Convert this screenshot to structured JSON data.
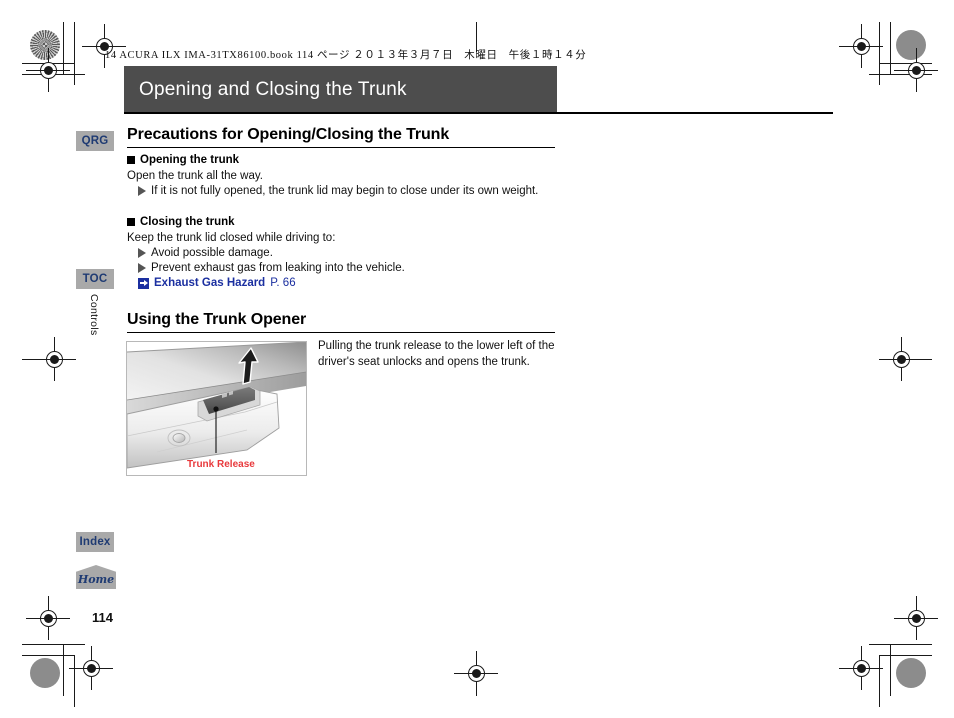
{
  "running_header": "14 ACURA ILX IMA-31TX86100.book  114 ページ  ２０１３年３月７日　木曜日　午後１時１４分",
  "banner": {
    "title": "Opening and Closing the Trunk"
  },
  "side_tabs": {
    "qrg": "QRG",
    "toc": "TOC",
    "index": "Index",
    "home": "Home",
    "chapter": "Controls"
  },
  "sections": [
    {
      "heading": "Precautions for Opening/Closing the Trunk",
      "subsections": [
        {
          "heading": "Opening the trunk",
          "body": "Open the trunk all the way.",
          "bullets": [
            "If it is not fully opened, the trunk lid may begin to close under its own weight."
          ]
        },
        {
          "heading": "Closing the trunk",
          "body": "Keep the trunk lid closed while driving to:",
          "bullets": [
            "Avoid possible damage.",
            "Prevent exhaust gas from leaking into the vehicle."
          ],
          "cross_reference": {
            "title": "Exhaust Gas Hazard",
            "page": "P. 66"
          }
        }
      ]
    },
    {
      "heading": "Using the Trunk Opener",
      "figure": {
        "caption": "Trunk Release"
      },
      "body": "Pulling the trunk release to the lower left of the driver's seat unlocks and opens the trunk."
    }
  ],
  "folio": "114",
  "colors": {
    "banner_bg": "#4d4d4d",
    "tab_bg": "#a9a9a9",
    "tab_text": "#1f3b73",
    "link": "#1b2fa0",
    "caption": "#e8393c"
  }
}
